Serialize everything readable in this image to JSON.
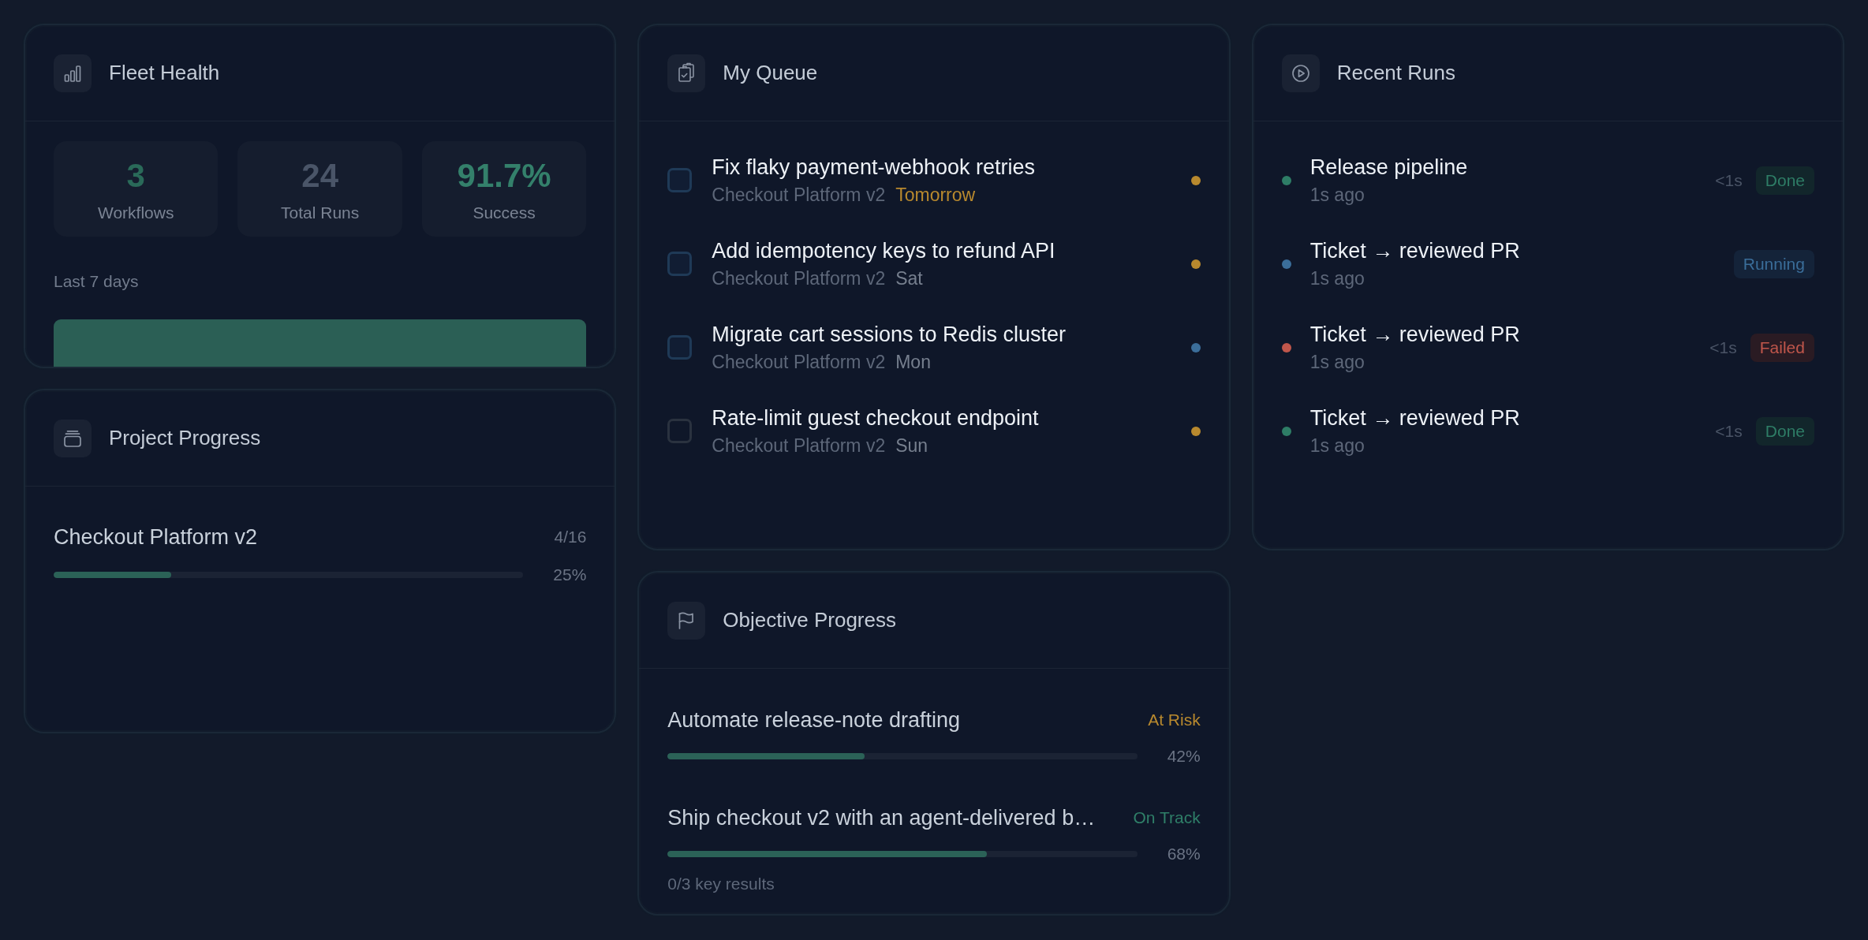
{
  "fleet_health": {
    "title": "Fleet Health",
    "stats": [
      {
        "value": "3",
        "label": "Workflows",
        "color": "#2a6a59"
      },
      {
        "value": "24",
        "label": "Total Runs",
        "color": "#4a5568"
      },
      {
        "value": "91.7%",
        "label": "Success",
        "color": "#34806b"
      }
    ],
    "chart_caption": "Last 7 days"
  },
  "my_queue": {
    "title": "My Queue",
    "tasks": [
      {
        "title": "Fix flaky payment-webhook retries",
        "project": "Checkout Platform v2",
        "due": "Tomorrow",
        "due_soon": true,
        "checked": false,
        "kind": "highlighted",
        "color": "#b8892e"
      },
      {
        "title": "Add idempotency keys to refund API",
        "project": "Checkout Platform v2",
        "due": "Sat",
        "due_soon": false,
        "checked": false,
        "kind": "highlighted",
        "color": "#b8892e"
      },
      {
        "title": "Migrate cart sessions to Redis cluster",
        "project": "Checkout Platform v2",
        "due": "Mon",
        "due_soon": false,
        "checked": false,
        "kind": "highlighted",
        "color": "#3b6e9a"
      },
      {
        "title": "Rate-limit guest checkout endpoint",
        "project": "Checkout Platform v2",
        "due": "Sun",
        "due_soon": false,
        "checked": false,
        "kind": "plain",
        "color": "#b8892e"
      }
    ]
  },
  "recent_runs": {
    "title": "Recent Runs",
    "runs": [
      {
        "name": "Release pipeline",
        "time": "1s ago",
        "duration": "<1s",
        "status": "Done",
        "kind": "done",
        "color": "#2e7d66"
      },
      {
        "name": "Ticket → reviewed PR",
        "time": "1s ago",
        "status": "Running",
        "kind": "running",
        "color": "#3b6e9a"
      },
      {
        "name": "Ticket → reviewed PR",
        "time": "1s ago",
        "duration": "<1s",
        "status": "Failed",
        "kind": "failed",
        "color": "#c0564b"
      },
      {
        "name": "Ticket → reviewed PR",
        "time": "1s ago",
        "duration": "<1s",
        "status": "Done",
        "kind": "done",
        "color": "#2e7d66"
      }
    ]
  },
  "project_progress": {
    "title": "Project Progress",
    "projects": [
      {
        "name": "Checkout Platform v2",
        "count": "4/16",
        "level": 0.25,
        "percent": "25%"
      }
    ]
  },
  "objective_progress": {
    "title": "Objective Progress",
    "objectives": [
      {
        "title": "Automate release-note drafting",
        "status": "At Risk",
        "kind": "at_risk",
        "level": 0.42,
        "percent": "42%"
      },
      {
        "title": "Ship checkout v2 with an agent-delivered b…",
        "status": "On Track",
        "kind": "on_track",
        "level": 0.68,
        "percent": "68%",
        "key_results": "0/3 key results"
      }
    ]
  }
}
